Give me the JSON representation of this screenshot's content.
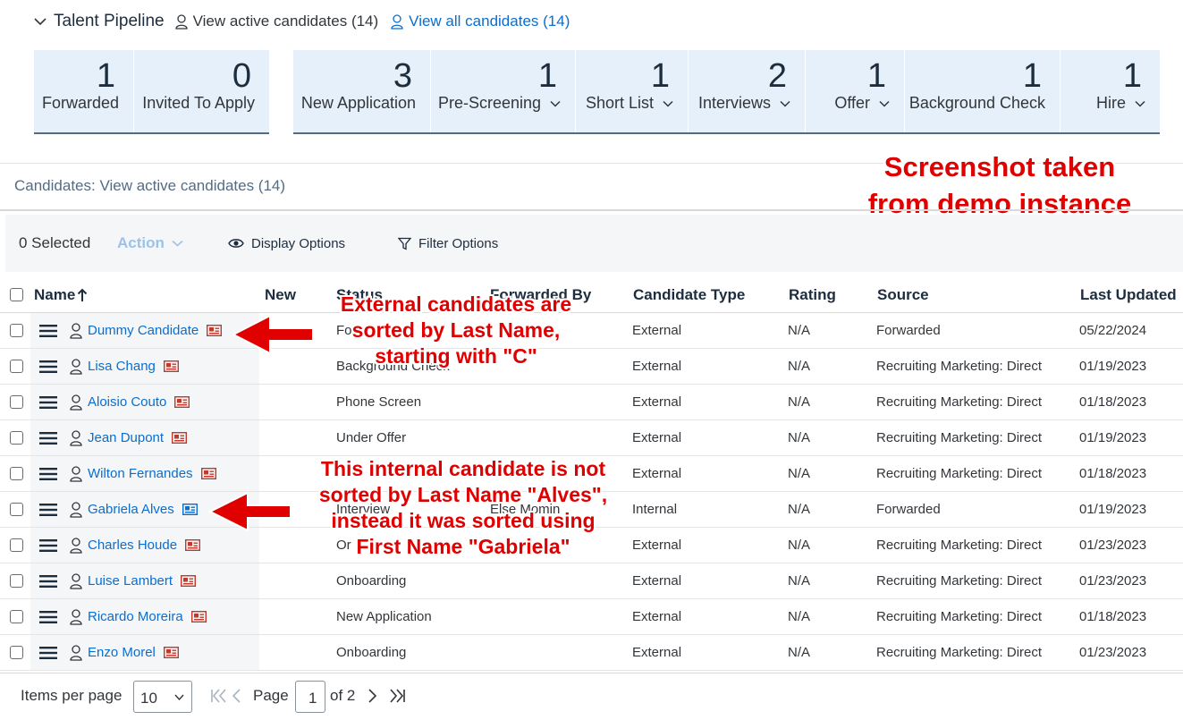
{
  "header": {
    "title": "Talent Pipeline",
    "view_active": "View active candidates (14)",
    "view_all": "View all candidates (14)"
  },
  "tiles_group1": [
    {
      "count": "1",
      "label": "Forwarded",
      "has_dropdown": false
    },
    {
      "count": "0",
      "label": "Invited To Apply",
      "has_dropdown": false
    }
  ],
  "tiles_group2": [
    {
      "count": "3",
      "label": "New Application",
      "has_dropdown": false
    },
    {
      "count": "1",
      "label": "Pre-Screening",
      "has_dropdown": true
    },
    {
      "count": "1",
      "label": "Short List",
      "has_dropdown": true
    },
    {
      "count": "2",
      "label": "Interviews",
      "has_dropdown": true
    },
    {
      "count": "1",
      "label": "Offer",
      "has_dropdown": true
    },
    {
      "count": "1",
      "label": "Background Check",
      "has_dropdown": false
    },
    {
      "count": "1",
      "label": "Hire",
      "has_dropdown": true
    }
  ],
  "candidates_title": "Candidates: View active candidates (14)",
  "toolbar": {
    "selected": "0 Selected",
    "action": "Action",
    "display_options": "Display Options",
    "filter_options": "Filter Options"
  },
  "columns": {
    "name": "Name",
    "new": "New",
    "status": "Status",
    "forwarded_by": "Forwarded By",
    "candidate_type": "Candidate Type",
    "rating": "Rating",
    "source": "Source",
    "last_updated": "Last Updated"
  },
  "rows": [
    {
      "name": "Dummy Candidate",
      "status": "Fo",
      "forwarded_by": "",
      "type": "External",
      "rating": "N/A",
      "source": "Forwarded",
      "updated": "05/22/2024",
      "badge": "#c0392b"
    },
    {
      "name": "Lisa Chang",
      "status": "Background Check",
      "forwarded_by": "",
      "type": "External",
      "rating": "N/A",
      "source": "Recruiting Marketing: Direct",
      "updated": "01/19/2023",
      "badge": "#c0392b"
    },
    {
      "name": "Aloisio Couto",
      "status": "Phone Screen",
      "forwarded_by": "",
      "type": "External",
      "rating": "N/A",
      "source": "Recruiting Marketing: Direct",
      "updated": "01/18/2023",
      "badge": "#c0392b"
    },
    {
      "name": "Jean Dupont",
      "status": "Under Offer",
      "forwarded_by": "",
      "type": "External",
      "rating": "N/A",
      "source": "Recruiting Marketing: Direct",
      "updated": "01/19/2023",
      "badge": "#c0392b"
    },
    {
      "name": "Wilton Fernandes",
      "status": "",
      "forwarded_by": "",
      "type": "External",
      "rating": "N/A",
      "source": "Recruiting Marketing: Direct",
      "updated": "01/18/2023",
      "badge": "#c0392b"
    },
    {
      "name": "Gabriela Alves",
      "status": "Interview",
      "forwarded_by": "Else Momin",
      "type": "Internal",
      "rating": "N/A",
      "source": "Forwarded",
      "updated": "01/19/2023",
      "badge": "#0a6ed1"
    },
    {
      "name": "Charles Houde",
      "status": "Or",
      "forwarded_by": "",
      "type": "External",
      "rating": "N/A",
      "source": "Recruiting Marketing: Direct",
      "updated": "01/23/2023",
      "badge": "#c0392b"
    },
    {
      "name": "Luise Lambert",
      "status": "Onboarding",
      "forwarded_by": "",
      "type": "External",
      "rating": "N/A",
      "source": "Recruiting Marketing: Direct",
      "updated": "01/23/2023",
      "badge": "#c0392b"
    },
    {
      "name": "Ricardo Moreira",
      "status": "New Application",
      "forwarded_by": "",
      "type": "External",
      "rating": "N/A",
      "source": "Recruiting Marketing: Direct",
      "updated": "01/18/2023",
      "badge": "#c0392b"
    },
    {
      "name": "Enzo Morel",
      "status": "Onboarding",
      "forwarded_by": "",
      "type": "External",
      "rating": "N/A",
      "source": "Recruiting Marketing: Direct",
      "updated": "01/23/2023",
      "badge": "#c0392b"
    }
  ],
  "footer": {
    "items_per_page_label": "Items per page",
    "items_per_page": "10",
    "page_label": "Page",
    "page": "1",
    "of_pages": "of 2"
  },
  "annotations": {
    "top_note": [
      "Screenshot taken",
      "from demo instance"
    ],
    "external_note": [
      "External candidates are",
      "sorted by Last Name,",
      "starting with \"C\""
    ],
    "internal_note": [
      "This internal candidate is not",
      "sorted by Last Name \"Alves\",",
      "instead it was sorted using",
      "First Name \"Gabriela\""
    ]
  },
  "colors": {
    "link": "#0a6ed1",
    "annotation": "#e00000",
    "tile_bg": "#e5f0fa"
  }
}
